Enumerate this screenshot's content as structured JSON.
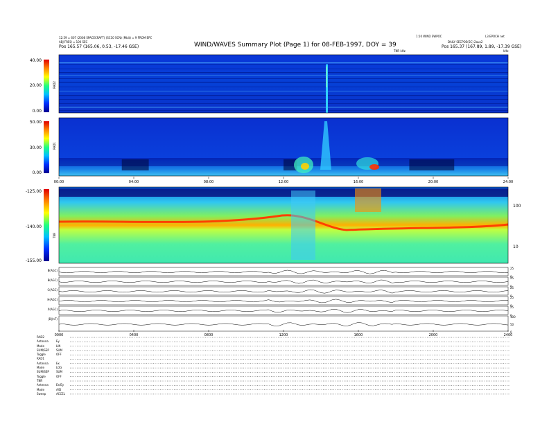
{
  "header": {
    "title": "WIND/WAVES Summary Plot (Page 1) for 08-FEB-1997, DOY = 39",
    "left_line1": "12:59 = 607 (2008 SPACECRAFT) (SC10 SCN) (Mbit) = 9 FROM EPC",
    "left_line2": "ABJ FREQ = 100 SEC",
    "left_line3": "Pos    165.57 (165.06, 0.53, -17.46 GSE)",
    "right_line1": "1:10 WIND SWPOC",
    "right_line1b": "L3 EPOCH net",
    "right_line2": "DAILY  SECPOS(SC) 2aux2",
    "right_line3": "Pos    165.37 (167.89, 1.89, -17.39 GSE)",
    "tnr_label": "TNR kHz",
    "rad_label": "kHz"
  },
  "panels": {
    "rad2": {
      "name": "RAD2",
      "ticks": [
        "40.00",
        "20.00",
        "0.00"
      ]
    },
    "rad1": {
      "name": "RAD1",
      "ticks": [
        "50.00",
        "30.00",
        "0.00"
      ]
    },
    "tnr": {
      "name": "TNR",
      "ticks": [
        "-125.00",
        "-140.00",
        "-155.00"
      ],
      "right_ticks": [
        "100",
        "10"
      ]
    },
    "time_ticks_top": [
      "00:00",
      "04:00",
      "08:00",
      "12:00",
      "16:00",
      "20:00",
      "24:00"
    ],
    "time_ticks_bottom": [
      "0000",
      "0400",
      "0800",
      "1200",
      "1600",
      "2000",
      "2400"
    ],
    "traces": [
      {
        "label": "B(AGC)",
        "right": [
          "25",
          "0"
        ]
      },
      {
        "label": "B(AGC)",
        "right": [
          "25",
          "0"
        ]
      },
      {
        "label": "C(AGC)",
        "right": [
          "25",
          "0"
        ]
      },
      {
        "label": "H(AGC)",
        "right": [
          "25",
          "0"
        ]
      },
      {
        "label": "X(AGC)",
        "right": [
          "25",
          "0"
        ]
      },
      {
        "label": "|B|(nT)",
        "right": [
          "100",
          "50",
          "0"
        ]
      }
    ]
  },
  "settings": [
    {
      "label": "RAD2",
      "value": ""
    },
    {
      "label": "Antenna",
      "value": "Ey"
    },
    {
      "label": "Mode",
      "value": "LIN"
    },
    {
      "label": "SUM/SEP",
      "value": "SUM"
    },
    {
      "label": "Toggle",
      "value": "OFF"
    },
    {
      "label": "RAD1",
      "value": ""
    },
    {
      "label": "Antenna",
      "value": "Ex"
    },
    {
      "label": "Mode",
      "value": "LOG"
    },
    {
      "label": "SUM/SEP",
      "value": "SUM"
    },
    {
      "label": "Toggle",
      "value": "OFF"
    },
    {
      "label": "TNR",
      "value": ""
    },
    {
      "label": "Antenna",
      "value": "Ex/Ey"
    },
    {
      "label": "Mode",
      "value": "A/D"
    },
    {
      "label": "Sweep",
      "value": "ACCEL"
    }
  ],
  "chart_data": {
    "type": "heatmap",
    "title": "WIND/WAVES Summary Plot (Page 1) for 08-FEB-1997, DOY = 39",
    "x": [
      "00:00",
      "04:00",
      "08:00",
      "12:00",
      "16:00",
      "20:00",
      "24:00"
    ],
    "panels": [
      {
        "name": "RAD2",
        "ylim": [
          0,
          40
        ],
        "colors": [
          "#0000a0",
          "#00d0ff",
          "#ffff00",
          "#ff0000"
        ]
      },
      {
        "name": "RAD1",
        "ylim": [
          0,
          50
        ]
      },
      {
        "name": "TNR",
        "ylim": [
          -155,
          -125
        ],
        "scale": "log",
        "right_axis": [
          10,
          100
        ]
      }
    ],
    "colorbar": [
      "#000090",
      "#0030ff",
      "#00c0ff",
      "#20ff80",
      "#ffff00",
      "#ff8000",
      "#e00000"
    ]
  }
}
